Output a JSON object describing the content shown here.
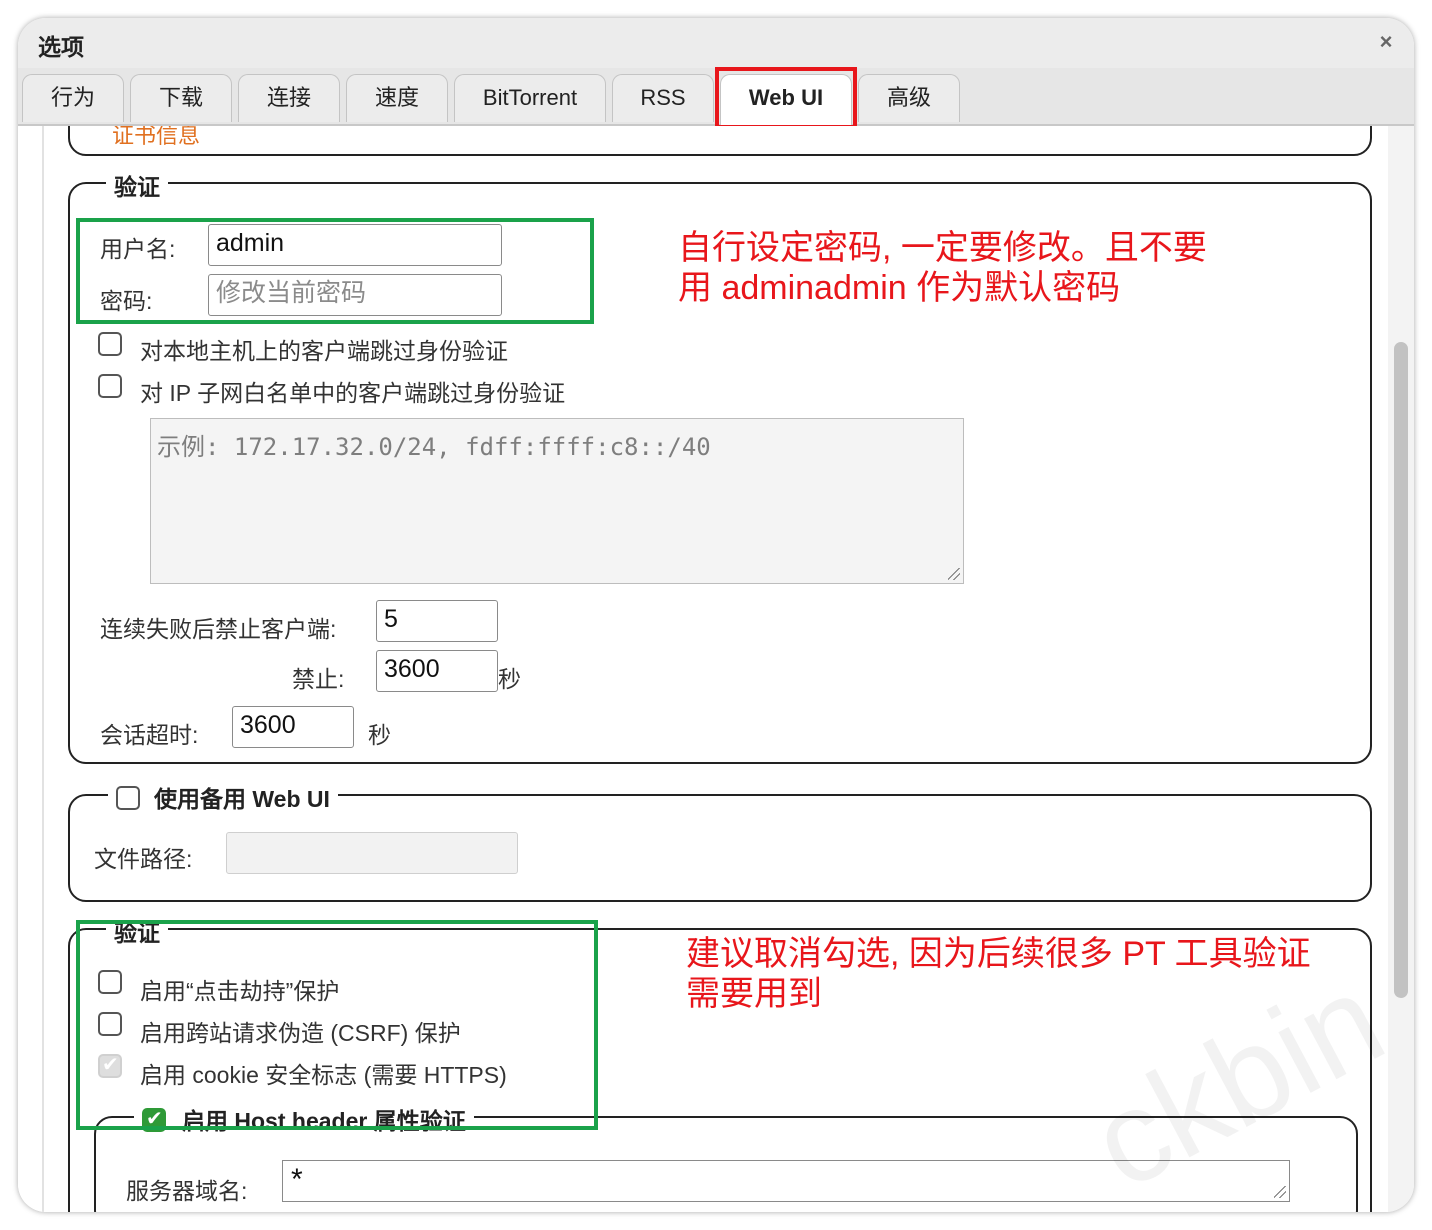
{
  "window": {
    "title": "选项",
    "close_label": "×"
  },
  "tabs": [
    {
      "label": "行为",
      "active": false
    },
    {
      "label": "下载",
      "active": false
    },
    {
      "label": "连接",
      "active": false
    },
    {
      "label": "速度",
      "active": false
    },
    {
      "label": "BitTorrent",
      "active": false
    },
    {
      "label": "RSS",
      "active": false
    },
    {
      "label": "Web UI",
      "active": true
    },
    {
      "label": "高级",
      "active": false
    }
  ],
  "https": {
    "cert_info_link": "证书信息"
  },
  "auth": {
    "legend": "验证",
    "username_label": "用户名:",
    "username_value": "admin",
    "password_label": "密码:",
    "password_placeholder": "修改当前密码",
    "bypass_localhost_label": "对本地主机上的客户端跳过身份验证",
    "bypass_localhost_checked": false,
    "bypass_subnet_label": "对 IP 子网白名单中的客户端跳过身份验证",
    "bypass_subnet_checked": false,
    "subnet_placeholder": "示例: 172.17.32.0/24, fdff:ffff:c8::/40",
    "ban_after_label": "连续失败后禁止客户端:",
    "ban_after_value": "5",
    "ban_duration_label": "禁止:",
    "ban_duration_value": "3600",
    "ban_duration_unit": "秒",
    "session_timeout_label": "会话超时:",
    "session_timeout_value": "3600",
    "session_timeout_unit": "秒"
  },
  "alt_webui": {
    "legend": "使用备用 Web UI",
    "checked": false,
    "file_path_label": "文件路径:",
    "file_path_value": ""
  },
  "security": {
    "legend": "验证",
    "clickjacking_label": "启用“点击劫持”保护",
    "clickjacking_checked": false,
    "csrf_label": "启用跨站请求伪造 (CSRF) 保护",
    "csrf_checked": false,
    "secure_cookie_label": "启用 cookie 安全标志 (需要 HTTPS)",
    "secure_cookie_checked": true,
    "host_header": {
      "legend": "启用 Host header 属性验证",
      "checked": true,
      "server_domains_label": "服务器域名:",
      "server_domains_value": "*"
    }
  },
  "annotations": {
    "password_note_line1": "自行设定密码, 一定要修改。且不要",
    "password_note_line2": "用 adminadmin 作为默认密码",
    "security_note_line1": "建议取消勾选, 因为后续很多 PT 工具验证",
    "security_note_line2": "需要用到",
    "watermark": "ckbin"
  },
  "colors": {
    "annotation_red": "#e8161b",
    "annotation_green": "#1aa24a",
    "checkbox_green": "#2e9a37"
  }
}
